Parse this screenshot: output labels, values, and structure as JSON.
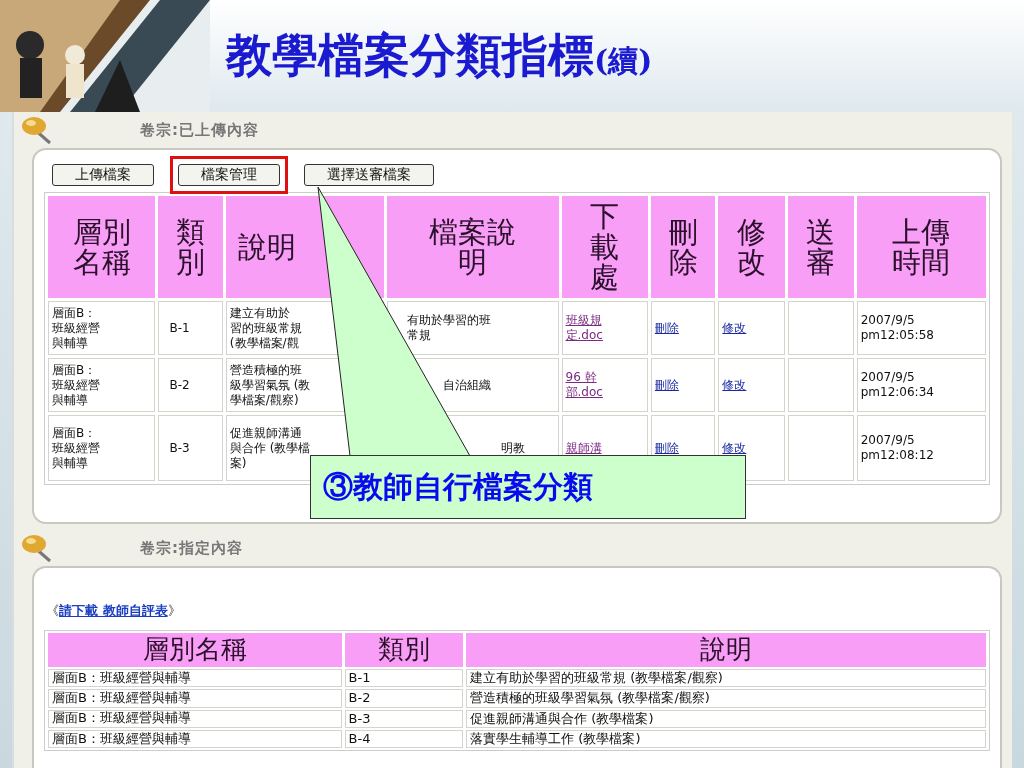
{
  "slide": {
    "title": "教學檔案分類指標",
    "title_suffix": "(續)"
  },
  "uploaded": {
    "heading": "卷宗:已上傳內容",
    "buttons": [
      {
        "label": "上傳檔案",
        "highlighted": false
      },
      {
        "label": "檔案管理",
        "highlighted": true
      },
      {
        "label": "選擇送審檔案",
        "highlighted": false
      }
    ],
    "columns": [
      "層別名稱",
      "類別",
      "說明",
      "檔案說明",
      "下載處",
      "刪除",
      "修改",
      "送審",
      "上傳時間"
    ],
    "rows": [
      {
        "layer": "層面B：班級經營與輔導",
        "category": "B-1",
        "description": [
          "建立有助於",
          "習的班級常規",
          "(教學檔案/觀"
        ],
        "file_description": [
          "有助於學習的班",
          "常規"
        ],
        "download": "班級規定.doc",
        "delete": "刪除",
        "edit": "修改",
        "upload_time": "2007/9/5 pm12:05:58"
      },
      {
        "layer": "層面B：班級經營與輔導",
        "category": "B-2",
        "description": [
          "營造積極的班",
          "級學習氣氛 (教",
          "學檔案/觀察)"
        ],
        "file_description": [
          "自治組織"
        ],
        "download": "96 幹部.doc",
        "delete": "刪除",
        "edit": "修改",
        "upload_time": "2007/9/5 pm12:06:34"
      },
      {
        "layer": "層面B：班級經營與輔導",
        "category": "B-3",
        "description": [
          "促進親師溝通",
          "與合作 (教學檔",
          "案)"
        ],
        "file_description": [
          "明教"
        ],
        "download": "親師溝",
        "delete": "刪除",
        "edit": "修改",
        "upload_time": "2007/9/5 pm12:08:12"
      }
    ]
  },
  "callout": {
    "text": "③教師自行檔案分類"
  },
  "assigned": {
    "heading": "卷宗:指定內容",
    "prompt_prefix": "《",
    "prompt_link": "請下載 教師自評表",
    "prompt_suffix": "》",
    "columns": [
      "層別名稱",
      "類別",
      "說明"
    ],
    "rows": [
      {
        "layer": "層面B：班級經營與輔導",
        "category": "B-1",
        "description": "建立有助於學習的班級常規 (教學檔案/觀察)"
      },
      {
        "layer": "層面B：班級經營與輔導",
        "category": "B-2",
        "description": "營造積極的班級學習氣氛 (教學檔案/觀察)"
      },
      {
        "layer": "層面B：班級經營與輔導",
        "category": "B-3",
        "description": "促進親師溝通與合作 (教學檔案)"
      },
      {
        "layer": "層面B：班級經營與輔導",
        "category": "B-4",
        "description": "落實學生輔導工作 (教學檔案)"
      }
    ]
  }
}
